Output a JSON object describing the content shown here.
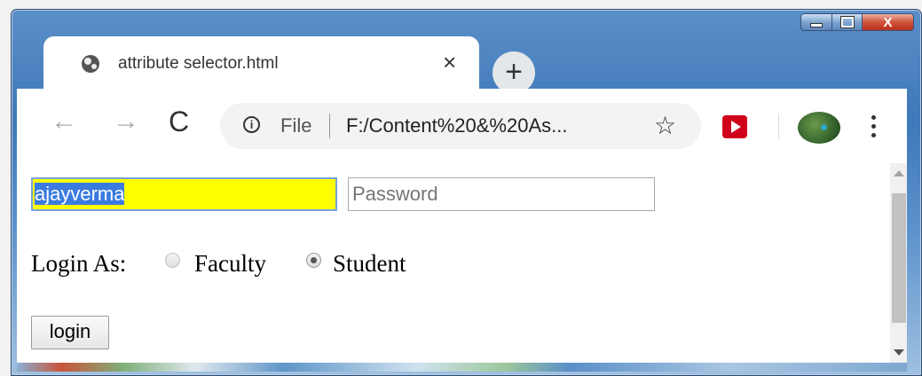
{
  "window": {
    "controls": {
      "minimize": "",
      "maximize": "",
      "close": "X"
    }
  },
  "tab": {
    "title": "attribute selector.html",
    "close_glyph": "×",
    "favicon": "globe-icon"
  },
  "new_tab": {
    "glyph": "+"
  },
  "toolbar": {
    "back_glyph": "←",
    "forward_glyph": "→",
    "reload_glyph": "C",
    "info_glyph": "i",
    "scheme_label": "File",
    "url": "F:/Content%20&%20As...",
    "star_glyph": "☆",
    "extension_icon": "youtube-icon",
    "profile_icon": "avatar",
    "menu_icon": "kebab-menu-icon"
  },
  "form": {
    "username_value": "ajayverma",
    "username_selected": true,
    "password_placeholder": "Password",
    "login_as_label": "Login As:",
    "radio_options": [
      {
        "label": "Faculty",
        "checked": false
      },
      {
        "label": "Student",
        "checked": true
      }
    ],
    "submit_label": "login"
  },
  "colors": {
    "username_background": "#ffff00",
    "selection": "#3b7be0",
    "youtube_red": "#d0021b"
  }
}
